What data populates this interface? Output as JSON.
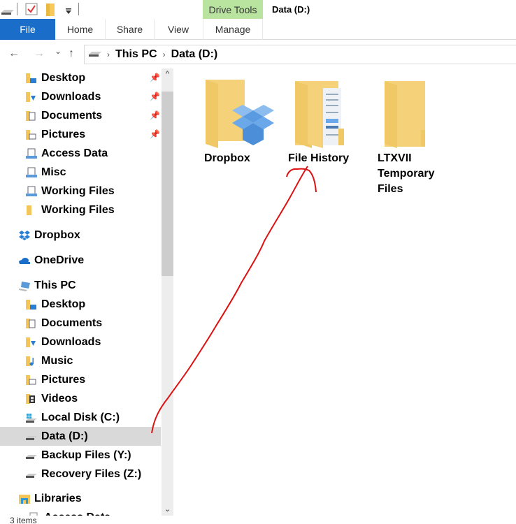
{
  "titlebar": {
    "quick_access": [
      "drive-icon",
      "properties-icon",
      "new-folder-icon",
      "customize-dropdown-icon"
    ],
    "context_tab_header": "Drive Tools",
    "window_title": "Data (D:)",
    "context_color": "#b8e4a0"
  },
  "ribbon": {
    "tabs": [
      {
        "label": "File",
        "active": true
      },
      {
        "label": "Home"
      },
      {
        "label": "Share"
      },
      {
        "label": "View"
      },
      {
        "label": "Manage"
      }
    ],
    "file_color": "#1a6ec9"
  },
  "navigation": {
    "back": "←",
    "forward": "→",
    "recent": "⌄",
    "up": "↑",
    "breadcrumb": [
      "This PC",
      "Data (D:)"
    ],
    "separator": "›"
  },
  "sidebar": {
    "quick_access": [
      {
        "label": "Desktop",
        "icon": "desktop-folder-icon",
        "pinned": true
      },
      {
        "label": "Downloads",
        "icon": "downloads-folder-icon",
        "pinned": true
      },
      {
        "label": "Documents",
        "icon": "documents-folder-icon",
        "pinned": true
      },
      {
        "label": "Pictures",
        "icon": "pictures-folder-icon",
        "pinned": true
      },
      {
        "label": "Access Data",
        "icon": "network-folder-icon"
      },
      {
        "label": "Misc",
        "icon": "network-folder-icon"
      },
      {
        "label": "Working Files",
        "icon": "network-folder-icon"
      },
      {
        "label": "Working Files",
        "icon": "folder-icon"
      }
    ],
    "dropbox": "Dropbox",
    "onedrive": "OneDrive",
    "this_pc": "This PC",
    "this_pc_items": [
      {
        "label": "Desktop",
        "icon": "desktop-folder-icon"
      },
      {
        "label": "Documents",
        "icon": "documents-folder-icon"
      },
      {
        "label": "Downloads",
        "icon": "downloads-folder-icon"
      },
      {
        "label": "Music",
        "icon": "music-folder-icon"
      },
      {
        "label": "Pictures",
        "icon": "pictures-folder-icon"
      },
      {
        "label": "Videos",
        "icon": "videos-folder-icon"
      },
      {
        "label": "Local Disk (C:)",
        "icon": "windows-drive-icon"
      },
      {
        "label": "Data (D:)",
        "icon": "drive-icon",
        "selected": true
      },
      {
        "label": "Backup Files (Y:)",
        "icon": "drive-icon"
      },
      {
        "label": "Recovery Files (Z:)",
        "icon": "drive-icon"
      }
    ],
    "libraries": "Libraries",
    "libraries_child_partial": "Access Data",
    "pin_glyph": "📌",
    "scroll_up": "^",
    "scroll_down": "⌄"
  },
  "content": {
    "items": [
      {
        "name": "Dropbox",
        "icon": "dropbox-folder-icon"
      },
      {
        "name": "File History",
        "icon": "document-folder-icon"
      },
      {
        "name": "LTXVII Temporary Files",
        "name_lines": [
          "LTXVII",
          "Temporary",
          "Files"
        ],
        "icon": "folder-icon"
      }
    ]
  },
  "status": {
    "item_count": "3 items"
  },
  "annotation": {
    "color": "#dd1111",
    "description": "red hand-drawn arrow from Data (D:) to File History"
  }
}
